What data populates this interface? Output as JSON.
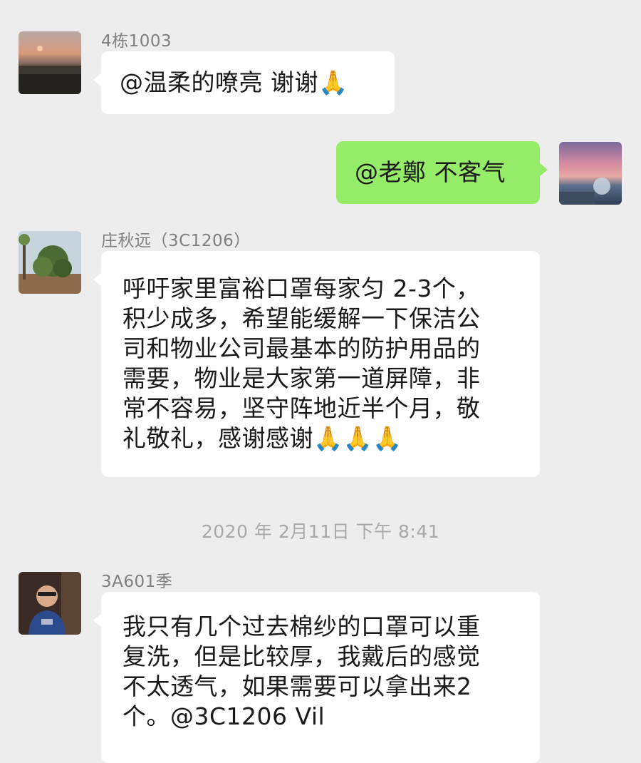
{
  "messages": [
    {
      "sender": "4栋1003",
      "lines": [
        "@温柔的嘹亮 谢谢🙏"
      ]
    },
    {
      "sender": "",
      "lines": [
        "@老鄭 不客气"
      ]
    },
    {
      "sender": "庄秋远（3C1206）",
      "lines": [
        "呼吁家里富裕口罩每家匀 2-3个，",
        "积少成多，希望能缓解一下保洁公",
        "司和物业公司最基本的防护用品的",
        "需要，物业是大家第一道屏障，非",
        "常不容易，坚守阵地近半个月，敬",
        "礼敬礼，感谢感谢🙏🙏🙏"
      ]
    },
    {
      "sender": "3A601季",
      "lines": [
        "我只有几个过去棉纱的口罩可以重",
        "复洗，但是比较厚，我戴后的感觉",
        "不太透气，如果需要可以拿出来2",
        "个。@3C1206 Vil"
      ]
    }
  ],
  "timestamp": "2020 年 2月11日 下午 8:41",
  "colors": {
    "background": "#ededed",
    "incoming_bubble": "#ffffff",
    "outgoing_bubble": "#95ec69",
    "sender_text": "#7f7f7f",
    "timestamp_text": "#a8a8a8"
  }
}
